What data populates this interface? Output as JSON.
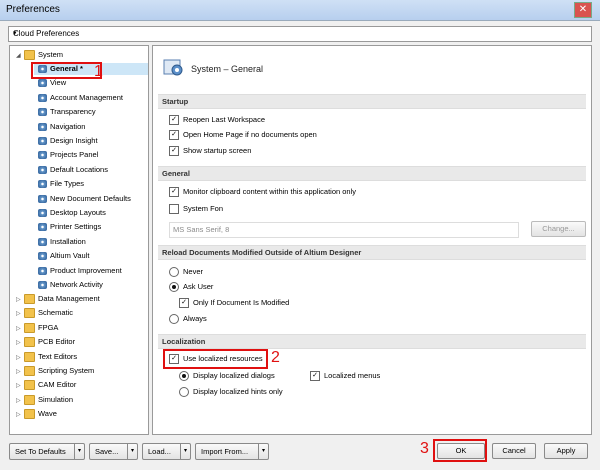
{
  "window": {
    "title": "Preferences",
    "close_glyph": "✕"
  },
  "profile": {
    "value": "Cloud Preferences"
  },
  "tree": {
    "root": "System",
    "items": [
      "General *",
      "View",
      "Account Management",
      "Transparency",
      "Navigation",
      "Design Insight",
      "Projects Panel",
      "Default Locations",
      "File Types",
      "New Document Defaults",
      "Desktop Layouts",
      "Printer Settings",
      "Installation",
      "Altium Vault",
      "Product Improvement",
      "Network Activity"
    ],
    "folders": [
      "Data Management",
      "Schematic",
      "FPGA",
      "PCB Editor",
      "Text Editors",
      "Scripting System",
      "CAM Editor",
      "Simulation",
      "Wave"
    ]
  },
  "panel": {
    "title": "System – General",
    "startup": {
      "header": "Startup",
      "reopen": "Reopen Last Workspace",
      "home": "Open Home Page if no documents open",
      "splash": "Show startup screen"
    },
    "general": {
      "header": "General",
      "clipboard": "Monitor clipboard content within this application only",
      "system_font": "System Fon",
      "font_value": "MS Sans Serif, 8",
      "change": "Change..."
    },
    "reload": {
      "header": "Reload Documents Modified Outside of Altium Designer",
      "never": "Never",
      "ask": "Ask User",
      "only_if": "Only If Document Is Modified",
      "always": "Always"
    },
    "localization": {
      "header": "Localization",
      "use": "Use localized resources",
      "dialogs": "Display localized dialogs",
      "hints": "Display localized hints only",
      "menus": "Localized menus"
    }
  },
  "annotations": {
    "n1": "1",
    "n2": "2",
    "n3": "3"
  },
  "footer": {
    "set_defaults": "Set To Defaults",
    "save": "Save...",
    "load": "Load...",
    "import": "Import From...",
    "ok": "OK",
    "cancel": "Cancel",
    "apply": "Apply"
  },
  "icons": {
    "dropdown": "▾",
    "check": "✓",
    "expand": "▷",
    "collapse": "◢"
  }
}
